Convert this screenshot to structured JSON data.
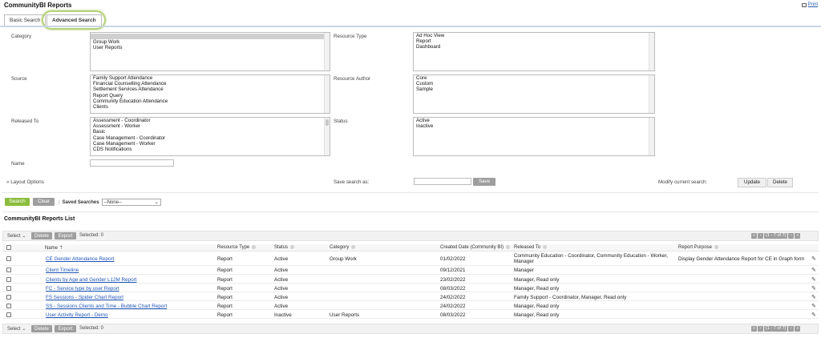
{
  "app": {
    "title": "CommunityBI Reports",
    "print_label": "Print"
  },
  "tabs": [
    {
      "label": "Basic Search"
    },
    {
      "label": "Advanced Search"
    }
  ],
  "filters": {
    "category": {
      "label": "Category",
      "options": [
        "",
        "Group Work",
        "User Reports"
      ],
      "selected_index": 0
    },
    "resource_type": {
      "label": "Resource Type",
      "options": [
        "Ad Hoc View",
        "Report",
        "Dashboard"
      ]
    },
    "source": {
      "label": "Source",
      "options": [
        "Family Support Attendance",
        "Financial Counselling Attendance",
        "Settlement Services Attendance",
        "Report Query",
        "Community Education Attendance",
        "Clients"
      ]
    },
    "resource_author": {
      "label": "Resource Author",
      "options": [
        "Core",
        "Custom",
        "Sample"
      ]
    },
    "released_to": {
      "label": "Released To",
      "options": [
        "Assessment - Coordinator",
        "Assessment - Worker",
        "Basic",
        "Case Management - Coordinator",
        "Case Management - Worker",
        "CDS Notifications"
      ]
    },
    "status": {
      "label": "Status",
      "options": [
        "Active",
        "Inactive"
      ]
    },
    "name": {
      "label": "Name",
      "value": ""
    }
  },
  "layout_options": {
    "label": "Layout Options"
  },
  "save_search": {
    "label": "Save search as:",
    "value": "",
    "button": "Save"
  },
  "modify_search": {
    "label": "Modify current search:",
    "update": "Update",
    "delete": "Delete"
  },
  "actions": {
    "search": "Search",
    "clear": "Clear",
    "saved_searches_label": "Saved Searches",
    "saved_searches_value": "--None--"
  },
  "list": {
    "title": "CommunityBI Reports List",
    "select_label": "Select",
    "delete_label": "Delete",
    "export_label": "Export",
    "selected_text": "Selected: 0",
    "pager_text": "(1 - 7 of 7)",
    "columns": [
      "Name",
      "Resource Type",
      "Status",
      "Category",
      "Created Date (Community BI)",
      "Released To",
      "Report Purpose"
    ],
    "rows": [
      {
        "name": "CE Gender Attendance Report",
        "type": "Report",
        "status": "Active",
        "category": "Group Work",
        "created": "01/02/2022",
        "released_1": "Community Education - Coordinator, Community Education - Worker,",
        "released_2": "Manager",
        "purpose": "Display Gender Attendance Report for CE in Graph form"
      },
      {
        "name": "Client Timeline",
        "type": "Report",
        "status": "Active",
        "category": "",
        "created": "09/12/2021",
        "released_1": "Manager",
        "released_2": "",
        "purpose": ""
      },
      {
        "name": "Clients by Age and Gender L12M Report",
        "type": "Report",
        "status": "Active",
        "category": "",
        "created": "23/02/2022",
        "released_1": "Manager, Read only",
        "released_2": "",
        "purpose": ""
      },
      {
        "name": "FC - Service type by user Report",
        "type": "Report",
        "status": "Active",
        "category": "",
        "created": "08/03/2022",
        "released_1": "Manager, Read only",
        "released_2": "",
        "purpose": ""
      },
      {
        "name": "FS Sessions - Spider Chart Report",
        "type": "Report",
        "status": "Active",
        "category": "",
        "created": "24/02/2022",
        "released_1": "Family Support - Coordinator, Manager, Read only",
        "released_2": "",
        "purpose": ""
      },
      {
        "name": "SS - Sessions Clients and Time - Bubble Chart Report",
        "type": "Report",
        "status": "Active",
        "category": "",
        "created": "24/02/2022",
        "released_1": "Manager, Read only",
        "released_2": "",
        "purpose": ""
      },
      {
        "name": "User Activity Report - Demo",
        "type": "Report",
        "status": "Inactive",
        "category": "User Reports",
        "created": "08/03/2022",
        "released_1": "Manager, Read only",
        "released_2": "",
        "purpose": ""
      }
    ]
  }
}
